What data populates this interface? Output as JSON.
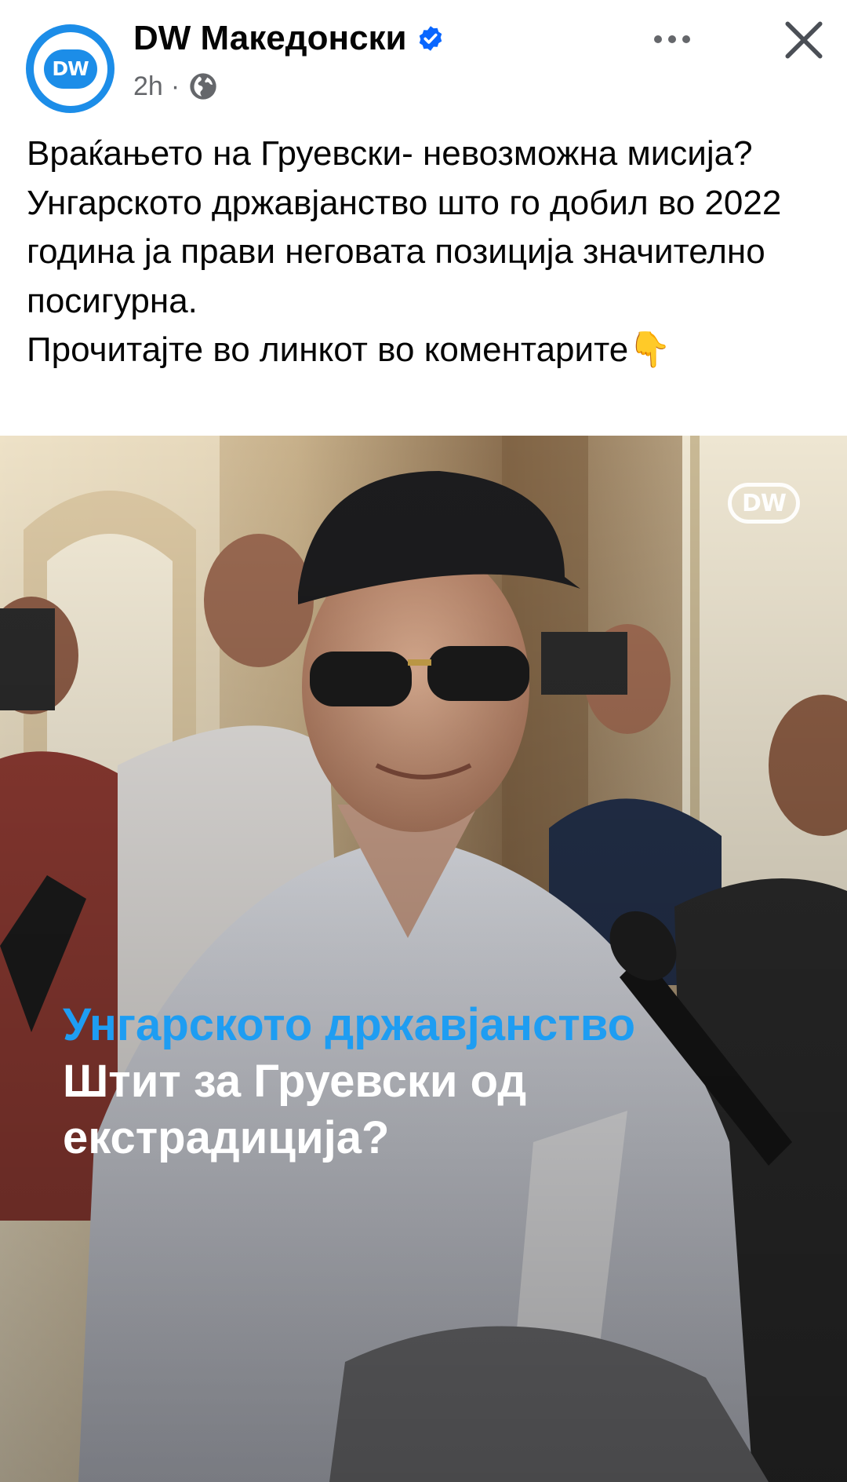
{
  "header": {
    "page_name": "DW Македонски",
    "time": "2h",
    "separator": "·",
    "avatar_logo_text": "DW"
  },
  "caption": {
    "lines": [
      "Враќањето на Груевски- невозможна мисија?",
      "Унгарското државјанство што го добил во 2022 година ја прави неговата позиција значително посигурна.",
      "Прочитајте во линкот во коментарите👇"
    ]
  },
  "image": {
    "watermark": "DW",
    "headline_accent": "Унгарското државјанство",
    "headline": "Штит за Груевски од екстрадиција?",
    "accent_color": "#1e9df2"
  },
  "icons": {
    "verified": "verified-badge-icon",
    "audience": "globe-icon",
    "more": "more-options-icon",
    "close": "close-icon",
    "pointing": "backhand-index-pointing-down-emoji"
  },
  "colors": {
    "verified_blue": "#0866ff",
    "brand_blue": "#1c8de8",
    "secondary_text": "#65676b"
  }
}
